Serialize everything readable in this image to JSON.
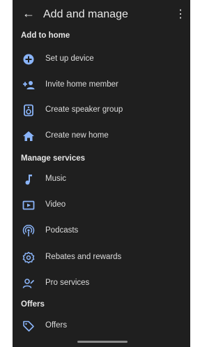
{
  "header": {
    "title": "Add and manage"
  },
  "sections": [
    {
      "title": "Add to home",
      "items": [
        {
          "label": "Set up device",
          "icon": "plus-circle-icon"
        },
        {
          "label": "Invite home member",
          "icon": "add-person-icon"
        },
        {
          "label": "Create speaker group",
          "icon": "speaker-icon"
        },
        {
          "label": "Create new home",
          "icon": "home-icon"
        }
      ]
    },
    {
      "title": "Manage services",
      "items": [
        {
          "label": "Music",
          "icon": "music-note-icon"
        },
        {
          "label": "Video",
          "icon": "video-icon"
        },
        {
          "label": "Podcasts",
          "icon": "podcast-icon"
        },
        {
          "label": "Rebates and rewards",
          "icon": "rebate-icon"
        },
        {
          "label": "Pro services",
          "icon": "pro-services-icon"
        }
      ]
    },
    {
      "title": "Offers",
      "items": [
        {
          "label": "Offers",
          "icon": "tag-icon"
        }
      ]
    }
  ],
  "colors": {
    "accent": "#8ab4f8",
    "background": "#1f1f1f",
    "text": "#e8e8e8"
  }
}
